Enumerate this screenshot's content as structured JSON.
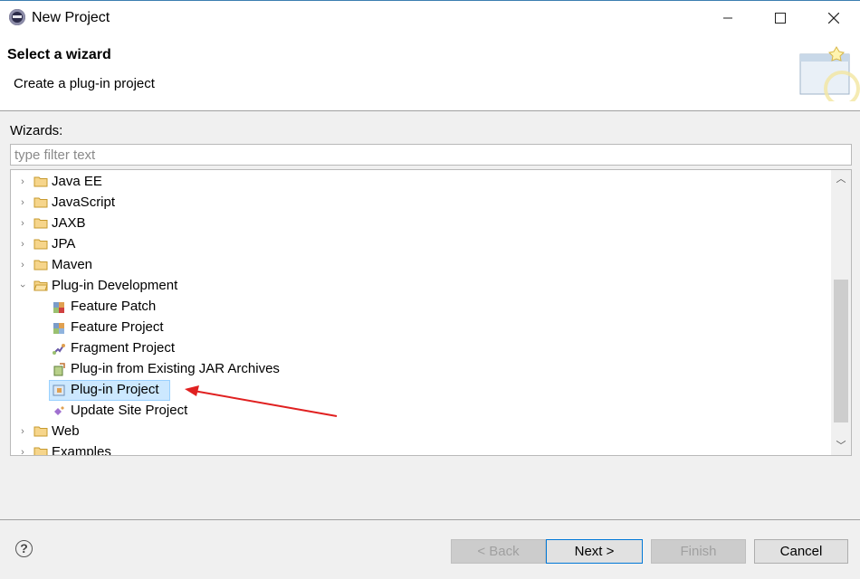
{
  "window": {
    "title": "New Project",
    "minimize_icon": "minimize-icon",
    "maximize_icon": "maximize-icon",
    "close_icon": "close-icon"
  },
  "banner": {
    "title": "Select a wizard",
    "description": "Create a plug-in project"
  },
  "wizards": {
    "label": "Wizards:",
    "filter_placeholder": "type filter text",
    "items": [
      {
        "label": "Java EE",
        "expanded": false
      },
      {
        "label": "JavaScript",
        "expanded": false
      },
      {
        "label": "JAXB",
        "expanded": false
      },
      {
        "label": "JPA",
        "expanded": false
      },
      {
        "label": "Maven",
        "expanded": false
      },
      {
        "label": "Plug-in Development",
        "expanded": true,
        "children": [
          {
            "label": "Feature Patch",
            "icon": "feature-patch-icon"
          },
          {
            "label": "Feature Project",
            "icon": "feature-project-icon"
          },
          {
            "label": "Fragment Project",
            "icon": "fragment-project-icon"
          },
          {
            "label": "Plug-in from Existing JAR Archives",
            "icon": "plugin-from-jar-icon"
          },
          {
            "label": "Plug-in Project",
            "icon": "plugin-project-icon",
            "selected": true
          },
          {
            "label": "Update Site Project",
            "icon": "update-site-icon"
          }
        ]
      },
      {
        "label": "Web",
        "expanded": false
      },
      {
        "label": "Examples",
        "expanded": false
      }
    ]
  },
  "buttons": {
    "back": "< Back",
    "next": "Next >",
    "finish": "Finish",
    "cancel": "Cancel",
    "help": "?"
  },
  "colors": {
    "selection": "#cce8ff",
    "annotation_arrow": "#e02020",
    "default_button_border": "#0078d7"
  }
}
